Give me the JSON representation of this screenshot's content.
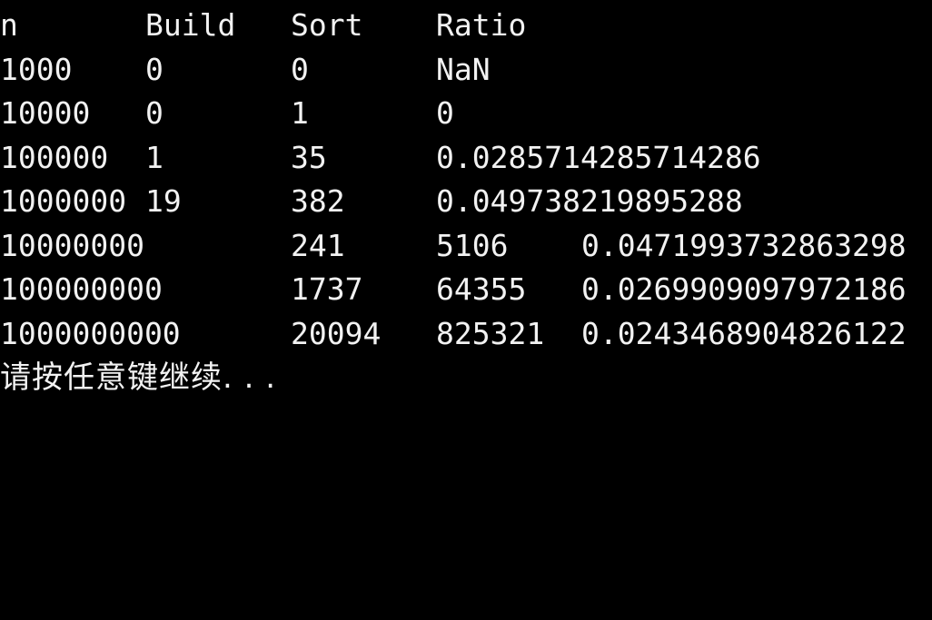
{
  "console": {
    "text_color": "#f2f2f2",
    "background_color": "#000000",
    "header": [
      "n",
      "Build",
      "Sort",
      "Ratio"
    ],
    "rows": [
      [
        "1000",
        "0",
        "0",
        "NaN",
        ""
      ],
      [
        "10000",
        "0",
        "1",
        "0",
        ""
      ],
      [
        "100000",
        "1",
        "35",
        "0.0285714285714286",
        ""
      ],
      [
        "1000000",
        "19",
        "382",
        "0.049738219895288",
        ""
      ],
      [
        "10000000",
        "",
        "241",
        "5106",
        "0.0471993732863298"
      ],
      [
        "100000000",
        "",
        "1737",
        "64355",
        "0.0269909097972186"
      ],
      [
        "1000000000",
        "",
        "20094",
        "825321",
        "0.0243468904826122"
      ]
    ],
    "prompt": "请按任意键继续. . ."
  }
}
